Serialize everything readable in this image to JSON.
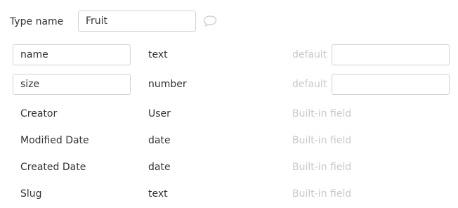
{
  "type_name": {
    "label": "Type name",
    "value": "Fruit"
  },
  "custom_fields": [
    {
      "name": "name",
      "type": "text",
      "default_label": "default",
      "default_value": ""
    },
    {
      "name": "size",
      "type": "number",
      "default_label": "default",
      "default_value": ""
    }
  ],
  "builtin_fields": [
    {
      "name": "Creator",
      "type": "User",
      "note": "Built-in field"
    },
    {
      "name": "Modified Date",
      "type": "date",
      "note": "Built-in field"
    },
    {
      "name": "Created Date",
      "type": "date",
      "note": "Built-in field"
    },
    {
      "name": "Slug",
      "type": "text",
      "note": "Built-in field"
    }
  ],
  "icons": {
    "comment": "speech-bubble-icon"
  }
}
